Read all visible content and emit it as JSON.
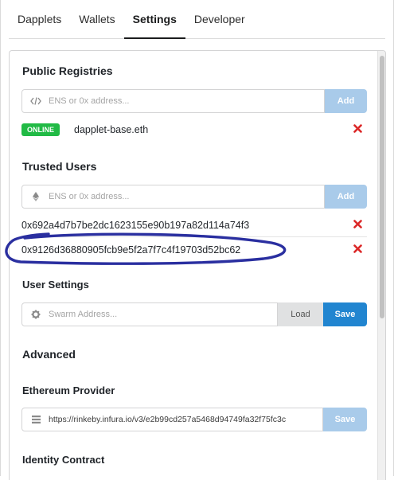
{
  "tabs": [
    "Dapplets",
    "Wallets",
    "Settings",
    "Developer"
  ],
  "active_tab": "Settings",
  "public_registries": {
    "title": "Public Registries",
    "placeholder": "ENS or 0x address...",
    "add_label": "Add",
    "items": [
      {
        "status": "ONLINE",
        "name": "dapplet-base.eth"
      }
    ]
  },
  "trusted_users": {
    "title": "Trusted Users",
    "placeholder": "ENS or 0x address...",
    "add_label": "Add",
    "items": [
      "0x692a4d7b7be2dc1623155e90b197a82d114a74f3",
      "0x9126d36880905fcb9e5f2a7f7c4f19703d52bc62"
    ]
  },
  "user_settings": {
    "title": "User Settings",
    "placeholder": "Swarm Address...",
    "load_label": "Load",
    "save_label": "Save"
  },
  "advanced": {
    "title": "Advanced",
    "ethereum_provider": {
      "title": "Ethereum Provider",
      "value": "https://rinkeby.infura.io/v3/e2b99cd257a5468d94749fa32f75fc3c",
      "save_label": "Save"
    },
    "identity_contract": {
      "title": "Identity Contract"
    }
  },
  "colors": {
    "accent": "#2185d0",
    "accent_disabled": "#a9cbea",
    "online": "#21ba45",
    "delete": "#db2828",
    "annotation": "#2a2fa0"
  }
}
